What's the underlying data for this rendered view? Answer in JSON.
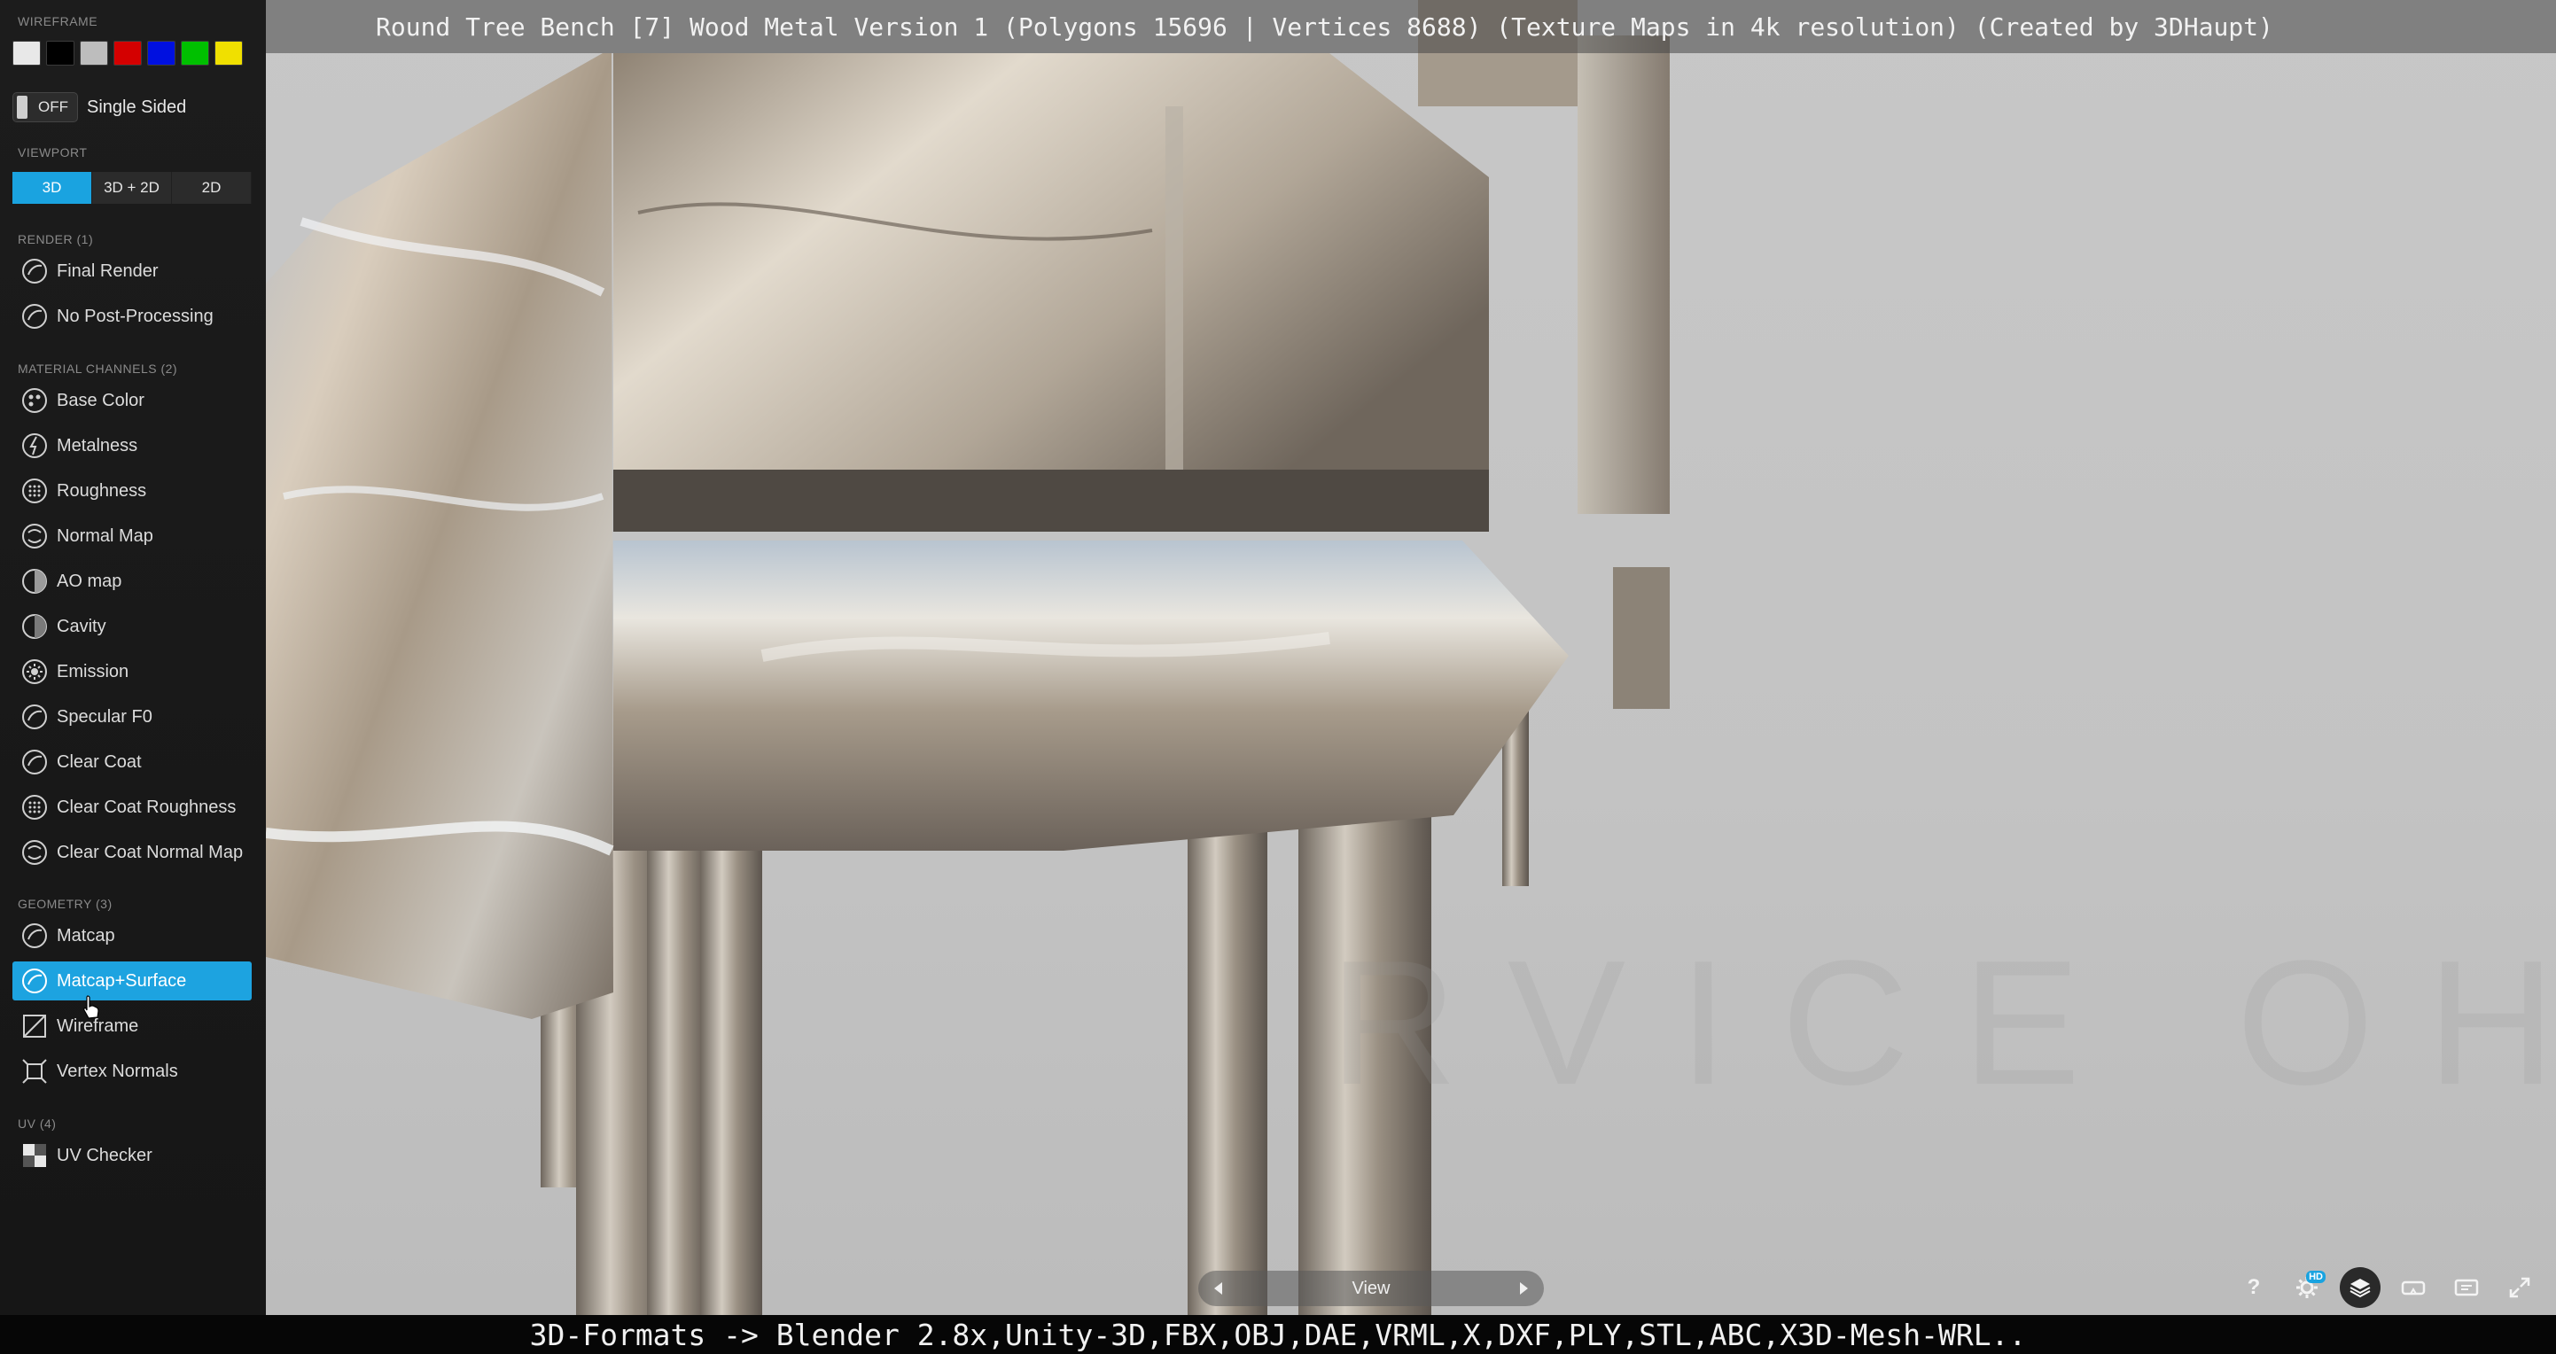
{
  "title": "Round Tree Bench [7] Wood Metal Version 1 (Polygons 15696 | Vertices 8688) (Texture Maps in 4k resolution) (Created by 3DHaupt)",
  "caption": "3D-Formats -> Blender 2.8x,Unity-3D,FBX,OBJ,DAE,VRML,X,DXF,PLY,STL,ABC,X3D-Mesh-WRL..",
  "watermark": "RVICE OHN",
  "sidebar": {
    "wireframe_label": "WIREFRAME",
    "wireframe_swatches": [
      "#e8e8e8",
      "#000000",
      "#bdbdbd",
      "#d40000",
      "#0010e0",
      "#00c000",
      "#f0e000"
    ],
    "single_sided": {
      "state": "OFF",
      "label": "Single Sided"
    },
    "viewport": {
      "label": "VIEWPORT",
      "modes": [
        "3D",
        "3D + 2D",
        "2D"
      ],
      "active": "3D"
    },
    "render": {
      "label": "RENDER (1)",
      "items": [
        {
          "label": "Final Render",
          "icon": "sphere-icon"
        },
        {
          "label": "No Post-Processing",
          "icon": "sphere-icon"
        }
      ]
    },
    "material": {
      "label": "MATERIAL CHANNELS (2)",
      "items": [
        {
          "label": "Base Color",
          "icon": "palette-icon"
        },
        {
          "label": "Metalness",
          "icon": "metalness-icon"
        },
        {
          "label": "Roughness",
          "icon": "dots-sphere-icon"
        },
        {
          "label": "Normal Map",
          "icon": "normal-map-icon"
        },
        {
          "label": "AO map",
          "icon": "half-sphere-icon"
        },
        {
          "label": "Cavity",
          "icon": "half-sphere-icon"
        },
        {
          "label": "Emission",
          "icon": "emission-icon"
        },
        {
          "label": "Specular F0",
          "icon": "sphere-icon"
        },
        {
          "label": "Clear Coat",
          "icon": "sphere-icon"
        },
        {
          "label": "Clear Coat Roughness",
          "icon": "dots-sphere-icon"
        },
        {
          "label": "Clear Coat Normal Map",
          "icon": "normal-map-icon"
        }
      ]
    },
    "geometry": {
      "label": "GEOMETRY (3)",
      "items": [
        {
          "label": "Matcap",
          "icon": "sphere-icon"
        },
        {
          "label": "Matcap+Surface",
          "icon": "sphere-icon",
          "active": true
        },
        {
          "label": "Wireframe",
          "icon": "wireframe-icon"
        },
        {
          "label": "Vertex Normals",
          "icon": "vertex-normals-icon"
        }
      ]
    },
    "uv": {
      "label": "UV (4)",
      "items": [
        {
          "label": "UV Checker",
          "icon": "checker-icon"
        }
      ]
    }
  },
  "controls": {
    "view_label": "View",
    "tools": [
      "help-icon",
      "settings-hd-icon",
      "layers-icon",
      "vr-icon",
      "embed-icon",
      "fullscreen-icon"
    ],
    "help_label": "?",
    "hd_badge": "HD"
  },
  "colors": {
    "accent": "#1da3e0",
    "sidebar_bg": "#181818",
    "viewport_bg": "#c4c4c4"
  }
}
